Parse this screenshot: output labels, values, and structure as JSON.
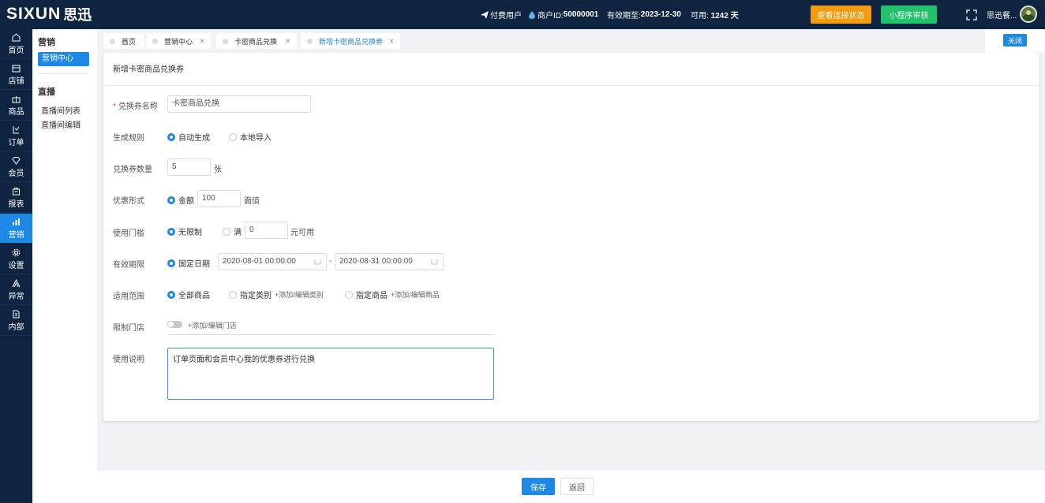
{
  "header": {
    "logo_latin": "SIXUN",
    "logo_cn": "思迅",
    "paid_user": "付费用户",
    "merchant_label": "商户ID:",
    "merchant_id": "50000001",
    "valid_until_label": "有效期至:",
    "valid_until": "2023-12-30",
    "available_label": "可用:",
    "available_days": "1242 天",
    "check_connection_btn": "查看连接状态",
    "miniprogram_review_btn": "小程序审核",
    "username": "思迅餐..."
  },
  "sidebar": {
    "items": [
      {
        "label": "首页",
        "icon": "home-icon"
      },
      {
        "label": "店铺",
        "icon": "store-icon"
      },
      {
        "label": "商品",
        "icon": "gift-icon"
      },
      {
        "label": "订单",
        "icon": "order-icon"
      },
      {
        "label": "会员",
        "icon": "diamond-icon"
      },
      {
        "label": "报表",
        "icon": "report-icon"
      },
      {
        "label": "营销",
        "icon": "bar-chart-icon",
        "active": true
      },
      {
        "label": "设置",
        "icon": "gear-icon"
      },
      {
        "label": "异常",
        "icon": "warning-icon"
      },
      {
        "label": "内部",
        "icon": "document-icon"
      }
    ]
  },
  "subnav": {
    "section1_title": "营销",
    "active_item": "营销中心",
    "section2_title": "直播",
    "links": [
      "直播间列表",
      "直播间编辑"
    ]
  },
  "tabs": [
    {
      "label": "首页",
      "closable": false
    },
    {
      "label": "营销中心",
      "closable": true
    },
    {
      "label": "卡密商品兑换",
      "closable": true
    },
    {
      "label": "新增卡密商品兑换券",
      "closable": true,
      "active": true
    }
  ],
  "close_button": "关闭",
  "form": {
    "title": "新增卡密商品兑换券",
    "name_label": "兑换券名称",
    "name_value": "卡密商品兑换",
    "rule_label": "生成规则",
    "rule_options": [
      "自动生成",
      "本地导入"
    ],
    "qty_label": "兑换券数量",
    "qty_value": "5",
    "qty_unit": "张",
    "discount_label": "优惠形式",
    "discount_option": "金额",
    "discount_value": "100",
    "discount_unit": "面值",
    "threshold_label": "使用门槛",
    "threshold_options": [
      "无限制",
      "满"
    ],
    "threshold_value": "0",
    "threshold_unit": "元可用",
    "validity_label": "有效期限",
    "validity_option": "固定日期",
    "date_start": "2020-08-01 00:00:00",
    "date_sep": "-",
    "date_end": "2020-08-31 00:00:00",
    "scope_label": "适用范围",
    "scope_options": [
      "全部商品",
      "指定类别",
      "指定商品"
    ],
    "scope_link_category": "+添加/编辑类别",
    "scope_link_goods": "+添加/编辑商品",
    "store_label": "限制门店",
    "store_link": "+添加/编辑门店",
    "desc_label": "使用说明",
    "desc_value": "订单页面和会员中心我的优惠券进行兑换"
  },
  "footer": {
    "save": "保存",
    "back": "返回"
  },
  "colors": {
    "nav_bg": "#0f2440",
    "primary": "#1e88e5",
    "orange": "#f29b0f",
    "green": "#1fc16a"
  }
}
